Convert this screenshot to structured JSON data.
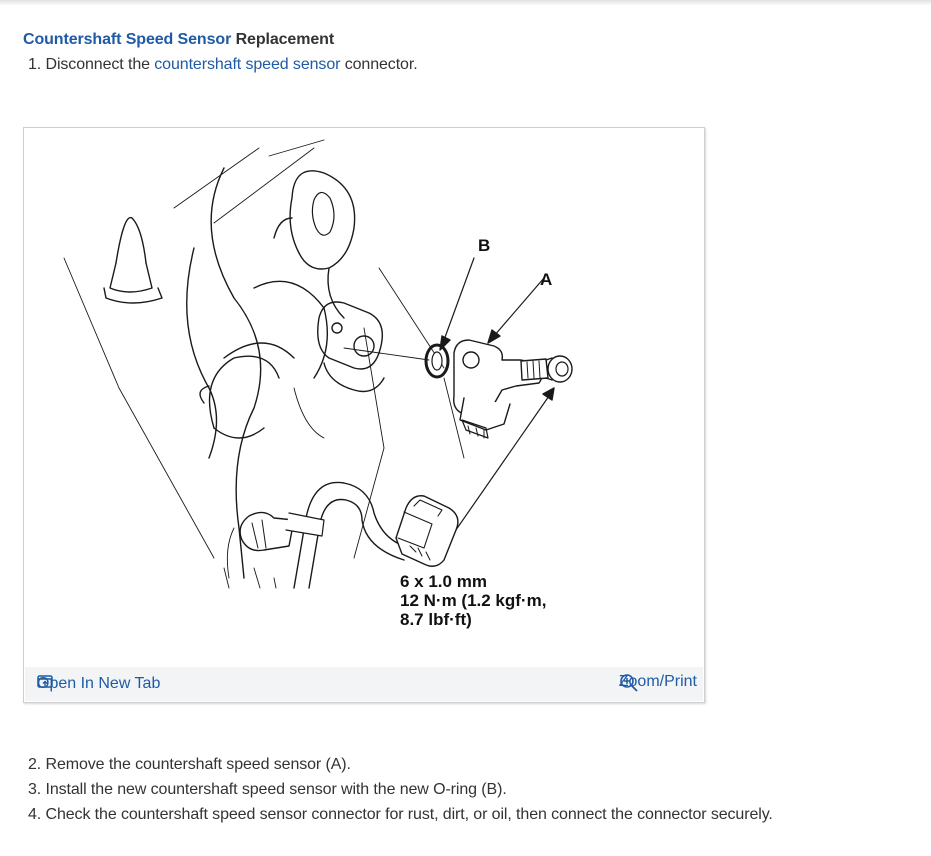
{
  "heading": {
    "link": "Countershaft Speed Sensor",
    "rest": " Replacement"
  },
  "steps": {
    "s1_prefix": "1. Disconnect the ",
    "s1_link": "countershaft speed sensor",
    "s1_suffix": " connector.",
    "s2": "2. Remove the countershaft speed sensor (A).",
    "s3": "3. Install the new countershaft speed sensor with the new O-ring (B).",
    "s4": "4. Check the countershaft speed sensor connector for rust, dirt, or oil, then connect the connector securely."
  },
  "figure": {
    "label_b": "B",
    "label_a": "A",
    "spec_line1": "6 x 1.0 mm",
    "spec_line2": "12 N·m (1.2 kgf·m,",
    "spec_line3": "8.7 lbf·ft)",
    "open_tab": "Open In New Tab",
    "zoom_print": "Zoom/Print"
  },
  "colors": {
    "link": "#1f5aa6",
    "text": "#333333",
    "bar": "#f3f4f6"
  }
}
